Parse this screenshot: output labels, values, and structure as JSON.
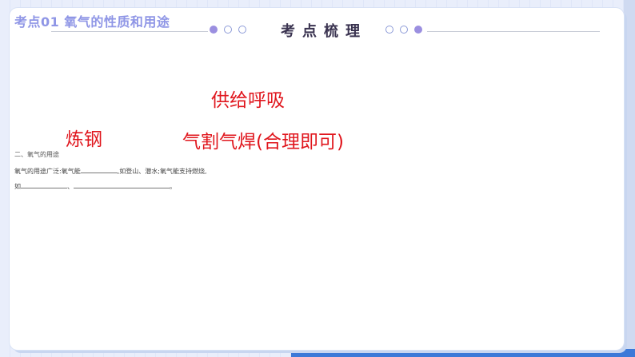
{
  "header": {
    "topic_title": "考点01 氧气的性质和用途",
    "section_title": "考点梳理"
  },
  "answers": {
    "breathing": "供给呼吸",
    "steelmaking": "炼钢",
    "welding": "气割气焊(合理即可)"
  },
  "document": {
    "heading": "二、氧气的用途",
    "line1_prefix": "氧气的用途广泛:氧气能",
    "line1_suffix": ",如登山、潜水;氧气能支持燃烧,",
    "line2_prefix": "如",
    "line2_separator": "、",
    "line2_suffix": "。"
  },
  "colors": {
    "answer_red": "#e0161d",
    "title_purple": "#8f96e6",
    "accent_blue": "#3c79d8"
  }
}
